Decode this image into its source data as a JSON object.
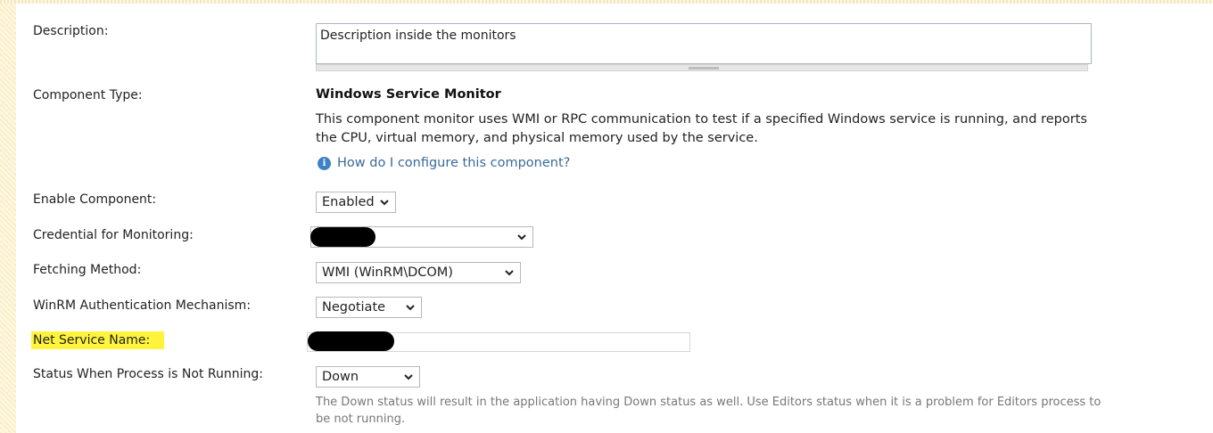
{
  "form": {
    "description": {
      "label": "Description:",
      "value": "Description inside the monitors"
    },
    "component_type": {
      "label": "Component Type:",
      "title": "Windows Service Monitor",
      "text": "This component monitor uses WMI or RPC communication to test if a specified Windows service is running, and reports the CPU, virtual memory, and physical memory used by the service.",
      "help_link": "How do I configure this component?",
      "help_icon": "info-icon"
    },
    "enable_component": {
      "label": "Enable Component:",
      "value": "Enabled"
    },
    "credential": {
      "label": "Credential for Monitoring:",
      "value": ""
    },
    "fetching_method": {
      "label": "Fetching Method:",
      "value": "WMI (WinRM\\DCOM)"
    },
    "winrm_auth": {
      "label": "WinRM Authentication Mechanism:",
      "value": "Negotiate"
    },
    "net_service_name": {
      "label": "Net Service Name:",
      "value": "",
      "highlight_color": "#fff43b"
    },
    "status_not_running": {
      "label": "Status When Process is Not Running:",
      "value": "Down",
      "hint": "The Down status will result in the application having Down status as well. Use Editors status when it is a problem for Editors process to be not running."
    }
  }
}
